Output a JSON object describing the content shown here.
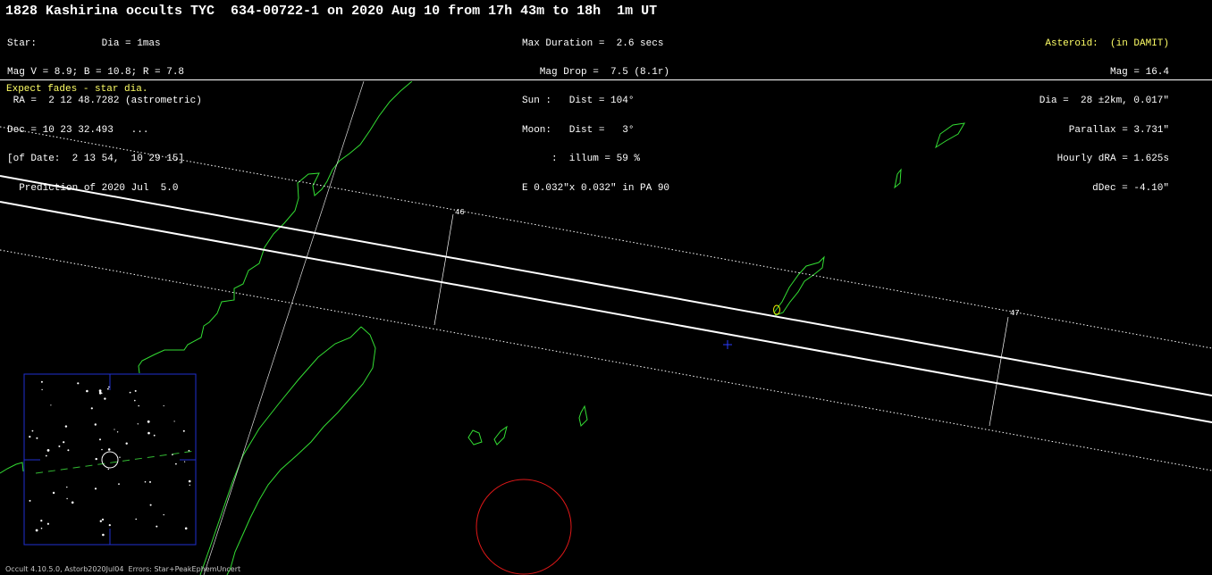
{
  "title": "1828 Kashirina occults TYC  634-00722-1 on 2020 Aug 10 from 17h 43m to 18h  1m UT",
  "star_block": {
    "lines": [
      "Star:           Dia = 1mas",
      "Mag V = 8.9; B = 10.8; R = 7.8",
      " RA =  2 12 48.7282 (astrometric)",
      "Dec = 10 23 32.493   ...",
      "[of Date:  2 13 54,  10 29 15]",
      "  Prediction of 2020 Jul  5.0"
    ]
  },
  "event_block": {
    "lines": [
      "Max Duration =  2.6 secs",
      "   Mag Drop =  7.5 (8.1r)",
      "Sun :   Dist = 104°",
      "Moon:   Dist =   3°",
      "     :  illum = 59 %",
      "E 0.032\"x 0.032\" in PA 90"
    ]
  },
  "asteroid_block": {
    "heading": "Asteroid:  (in DAMIT)",
    "lines": [
      "Mag = 16.4",
      "Dia =  28 ±2km, 0.017\"",
      "Parallax = 3.731\"",
      "Hourly dRA = 1.625s",
      "dDec = -4.10\""
    ]
  },
  "note": "Expect fades - star dia.",
  "time_ticks": [
    {
      "label": "46"
    },
    {
      "label": "47"
    }
  ],
  "footer": "Occult 4.10.5.0, Astorb2020Jul04  Errors: Star+PeakEphemUncert",
  "colors": {
    "background": "#000000",
    "text": "#ffffff",
    "highlight_text": "#ffff66",
    "coastline": "#33dd33",
    "path_lines": "#ffffff",
    "finder_frame": "#1f2fd0",
    "center_marker": "#2a3cff",
    "sun_circle": "#e01818"
  },
  "icons": {
    "center": "plus-marker-icon",
    "target_star": "ring-icon"
  }
}
